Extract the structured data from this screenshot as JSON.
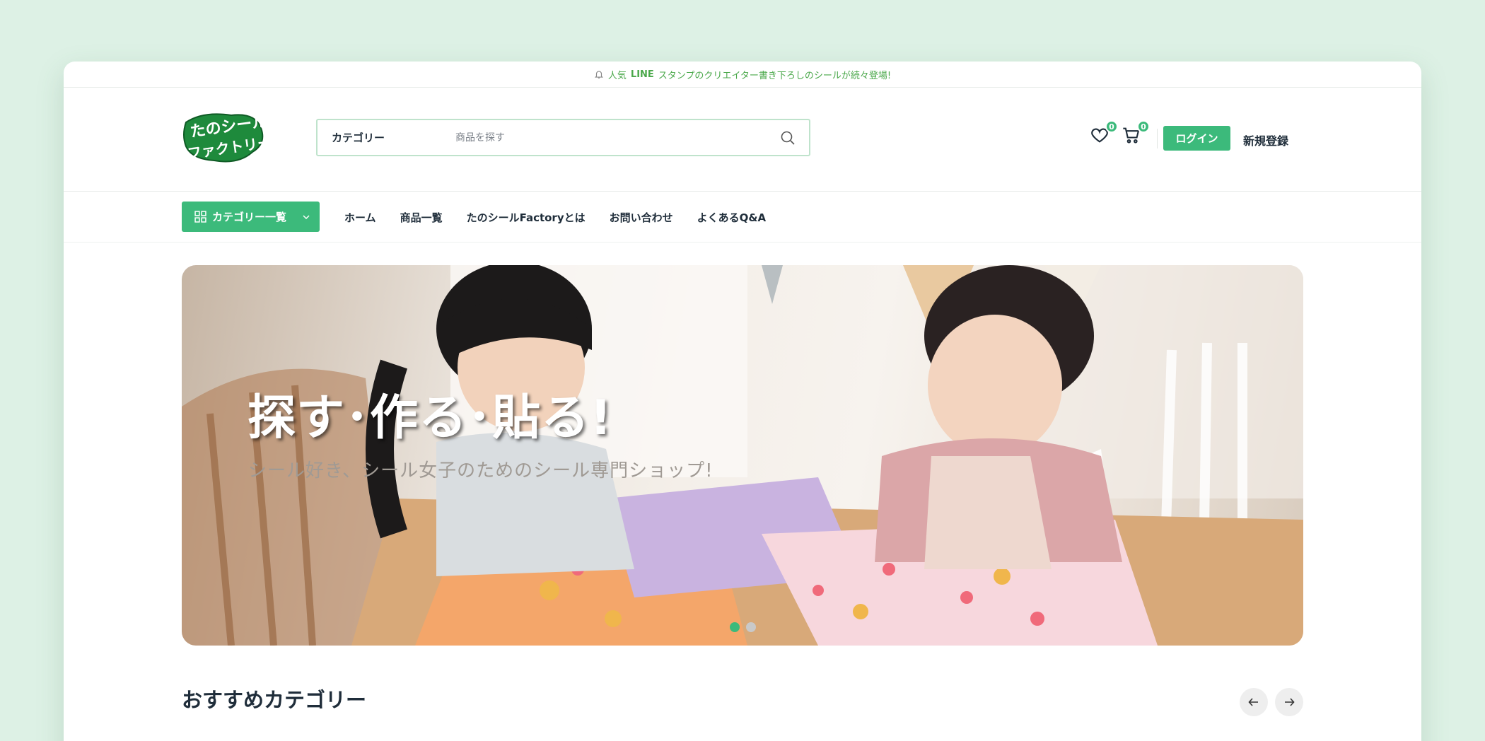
{
  "announcement": {
    "prefix": "人気",
    "highlight": "LINE",
    "suffix": "スタンプのクリエイター書き下ろしのシールが続々登場!"
  },
  "brand": {
    "logo_line1": "たのシール",
    "logo_line2": "ファクトリー",
    "accent_color": "#3cba7b",
    "logo_color": "#1e8a3c"
  },
  "search": {
    "category_label": "カテゴリー",
    "placeholder": "商品を探す"
  },
  "header": {
    "wishlist_count": "0",
    "cart_count": "0",
    "login_label": "ログイン",
    "register_label": "新規登録"
  },
  "nav": {
    "category_button": "カテゴリー一覧",
    "links": [
      "ホーム",
      "商品一覧",
      "たのシールFactoryとは",
      "お問い合わせ",
      "よくあるQ&A"
    ]
  },
  "hero": {
    "title": "探す･作る･貼る!",
    "subtitle": "シール好き、シール女子のためのシール専門ショップ!",
    "slide_count": 2,
    "active_slide": 1
  },
  "section": {
    "title": "おすすめカテゴリー"
  }
}
